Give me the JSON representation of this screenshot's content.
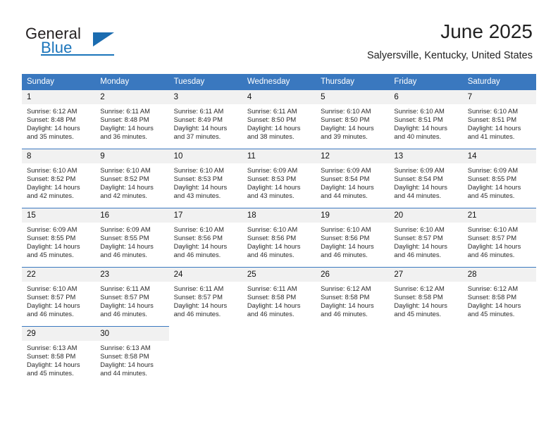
{
  "brand": {
    "name_part1": "General",
    "name_part2": "Blue",
    "accent_color": "#1b75bb",
    "triangle_icon": "brand-triangle-icon"
  },
  "header": {
    "month_title": "June 2025",
    "location": "Salyersville, Kentucky, United States"
  },
  "calendar": {
    "header_bg": "#3a78bf",
    "daynum_bg": "#f1f1f1",
    "weekdays": [
      "Sunday",
      "Monday",
      "Tuesday",
      "Wednesday",
      "Thursday",
      "Friday",
      "Saturday"
    ],
    "weeks": [
      [
        {
          "day": "1",
          "sunrise": "Sunrise: 6:12 AM",
          "sunset": "Sunset: 8:48 PM",
          "daylight1": "Daylight: 14 hours",
          "daylight2": "and 35 minutes."
        },
        {
          "day": "2",
          "sunrise": "Sunrise: 6:11 AM",
          "sunset": "Sunset: 8:48 PM",
          "daylight1": "Daylight: 14 hours",
          "daylight2": "and 36 minutes."
        },
        {
          "day": "3",
          "sunrise": "Sunrise: 6:11 AM",
          "sunset": "Sunset: 8:49 PM",
          "daylight1": "Daylight: 14 hours",
          "daylight2": "and 37 minutes."
        },
        {
          "day": "4",
          "sunrise": "Sunrise: 6:11 AM",
          "sunset": "Sunset: 8:50 PM",
          "daylight1": "Daylight: 14 hours",
          "daylight2": "and 38 minutes."
        },
        {
          "day": "5",
          "sunrise": "Sunrise: 6:10 AM",
          "sunset": "Sunset: 8:50 PM",
          "daylight1": "Daylight: 14 hours",
          "daylight2": "and 39 minutes."
        },
        {
          "day": "6",
          "sunrise": "Sunrise: 6:10 AM",
          "sunset": "Sunset: 8:51 PM",
          "daylight1": "Daylight: 14 hours",
          "daylight2": "and 40 minutes."
        },
        {
          "day": "7",
          "sunrise": "Sunrise: 6:10 AM",
          "sunset": "Sunset: 8:51 PM",
          "daylight1": "Daylight: 14 hours",
          "daylight2": "and 41 minutes."
        }
      ],
      [
        {
          "day": "8",
          "sunrise": "Sunrise: 6:10 AM",
          "sunset": "Sunset: 8:52 PM",
          "daylight1": "Daylight: 14 hours",
          "daylight2": "and 42 minutes."
        },
        {
          "day": "9",
          "sunrise": "Sunrise: 6:10 AM",
          "sunset": "Sunset: 8:52 PM",
          "daylight1": "Daylight: 14 hours",
          "daylight2": "and 42 minutes."
        },
        {
          "day": "10",
          "sunrise": "Sunrise: 6:10 AM",
          "sunset": "Sunset: 8:53 PM",
          "daylight1": "Daylight: 14 hours",
          "daylight2": "and 43 minutes."
        },
        {
          "day": "11",
          "sunrise": "Sunrise: 6:09 AM",
          "sunset": "Sunset: 8:53 PM",
          "daylight1": "Daylight: 14 hours",
          "daylight2": "and 43 minutes."
        },
        {
          "day": "12",
          "sunrise": "Sunrise: 6:09 AM",
          "sunset": "Sunset: 8:54 PM",
          "daylight1": "Daylight: 14 hours",
          "daylight2": "and 44 minutes."
        },
        {
          "day": "13",
          "sunrise": "Sunrise: 6:09 AM",
          "sunset": "Sunset: 8:54 PM",
          "daylight1": "Daylight: 14 hours",
          "daylight2": "and 44 minutes."
        },
        {
          "day": "14",
          "sunrise": "Sunrise: 6:09 AM",
          "sunset": "Sunset: 8:55 PM",
          "daylight1": "Daylight: 14 hours",
          "daylight2": "and 45 minutes."
        }
      ],
      [
        {
          "day": "15",
          "sunrise": "Sunrise: 6:09 AM",
          "sunset": "Sunset: 8:55 PM",
          "daylight1": "Daylight: 14 hours",
          "daylight2": "and 45 minutes."
        },
        {
          "day": "16",
          "sunrise": "Sunrise: 6:09 AM",
          "sunset": "Sunset: 8:55 PM",
          "daylight1": "Daylight: 14 hours",
          "daylight2": "and 46 minutes."
        },
        {
          "day": "17",
          "sunrise": "Sunrise: 6:10 AM",
          "sunset": "Sunset: 8:56 PM",
          "daylight1": "Daylight: 14 hours",
          "daylight2": "and 46 minutes."
        },
        {
          "day": "18",
          "sunrise": "Sunrise: 6:10 AM",
          "sunset": "Sunset: 8:56 PM",
          "daylight1": "Daylight: 14 hours",
          "daylight2": "and 46 minutes."
        },
        {
          "day": "19",
          "sunrise": "Sunrise: 6:10 AM",
          "sunset": "Sunset: 8:56 PM",
          "daylight1": "Daylight: 14 hours",
          "daylight2": "and 46 minutes."
        },
        {
          "day": "20",
          "sunrise": "Sunrise: 6:10 AM",
          "sunset": "Sunset: 8:57 PM",
          "daylight1": "Daylight: 14 hours",
          "daylight2": "and 46 minutes."
        },
        {
          "day": "21",
          "sunrise": "Sunrise: 6:10 AM",
          "sunset": "Sunset: 8:57 PM",
          "daylight1": "Daylight: 14 hours",
          "daylight2": "and 46 minutes."
        }
      ],
      [
        {
          "day": "22",
          "sunrise": "Sunrise: 6:10 AM",
          "sunset": "Sunset: 8:57 PM",
          "daylight1": "Daylight: 14 hours",
          "daylight2": "and 46 minutes."
        },
        {
          "day": "23",
          "sunrise": "Sunrise: 6:11 AM",
          "sunset": "Sunset: 8:57 PM",
          "daylight1": "Daylight: 14 hours",
          "daylight2": "and 46 minutes."
        },
        {
          "day": "24",
          "sunrise": "Sunrise: 6:11 AM",
          "sunset": "Sunset: 8:57 PM",
          "daylight1": "Daylight: 14 hours",
          "daylight2": "and 46 minutes."
        },
        {
          "day": "25",
          "sunrise": "Sunrise: 6:11 AM",
          "sunset": "Sunset: 8:58 PM",
          "daylight1": "Daylight: 14 hours",
          "daylight2": "and 46 minutes."
        },
        {
          "day": "26",
          "sunrise": "Sunrise: 6:12 AM",
          "sunset": "Sunset: 8:58 PM",
          "daylight1": "Daylight: 14 hours",
          "daylight2": "and 46 minutes."
        },
        {
          "day": "27",
          "sunrise": "Sunrise: 6:12 AM",
          "sunset": "Sunset: 8:58 PM",
          "daylight1": "Daylight: 14 hours",
          "daylight2": "and 45 minutes."
        },
        {
          "day": "28",
          "sunrise": "Sunrise: 6:12 AM",
          "sunset": "Sunset: 8:58 PM",
          "daylight1": "Daylight: 14 hours",
          "daylight2": "and 45 minutes."
        }
      ],
      [
        {
          "day": "29",
          "sunrise": "Sunrise: 6:13 AM",
          "sunset": "Sunset: 8:58 PM",
          "daylight1": "Daylight: 14 hours",
          "daylight2": "and 45 minutes."
        },
        {
          "day": "30",
          "sunrise": "Sunrise: 6:13 AM",
          "sunset": "Sunset: 8:58 PM",
          "daylight1": "Daylight: 14 hours",
          "daylight2": "and 44 minutes."
        },
        {
          "day": "",
          "sunrise": "",
          "sunset": "",
          "daylight1": "",
          "daylight2": ""
        },
        {
          "day": "",
          "sunrise": "",
          "sunset": "",
          "daylight1": "",
          "daylight2": ""
        },
        {
          "day": "",
          "sunrise": "",
          "sunset": "",
          "daylight1": "",
          "daylight2": ""
        },
        {
          "day": "",
          "sunrise": "",
          "sunset": "",
          "daylight1": "",
          "daylight2": ""
        },
        {
          "day": "",
          "sunrise": "",
          "sunset": "",
          "daylight1": "",
          "daylight2": ""
        }
      ]
    ]
  }
}
